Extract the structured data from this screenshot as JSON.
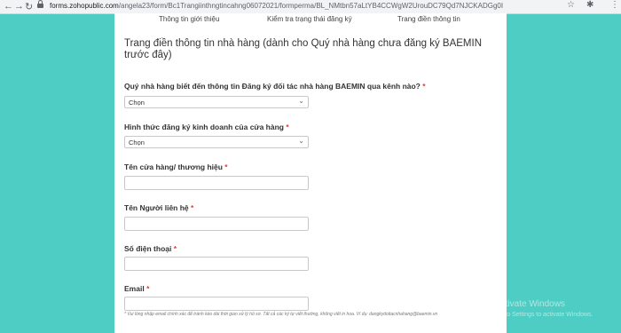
{
  "browser": {
    "back_icon": "←",
    "forward_icon": "→",
    "refresh_icon": "↻",
    "url_domain": "forms.zohopublic.com",
    "url_path": "/angela23/form/Bc1Trangiinthngtincahng06072021/formperma/BL_NMtbn57aLtYB4CCWgW2UrouDC79Qd7NJCKADGg0I",
    "star_icon": "☆",
    "extensions_icon": "✱",
    "menu_icon": "⋮"
  },
  "tabs": [
    "Thông tin giới thiệu",
    "Kiểm tra trạng thái đăng ký",
    "Trang điền thông tin"
  ],
  "form": {
    "heading": "Trang điền thông tin nhà hàng (dành cho Quý nhà hàng chưa đăng ký BAEMIN trước đây)",
    "q1_label": "Quý nhà hàng biết đến thông tin Đăng ký đối tác nhà hàng BAEMIN qua kênh nào?",
    "q1_value": "Chọn",
    "q2_label": "Hình thức đăng ký kinh doanh của cửa hàng",
    "q2_value": "Chọn",
    "store_name_label": "Tên cửa hàng/ thương hiệu",
    "contact_label": "Tên Người liên hệ",
    "phone_label": "Số điện thoại",
    "email_label": "Email",
    "required_mark": "*",
    "email_hint": "* Vui lòng nhập email chính xác để tránh kéo dài thời gian xử lý hồ sơ. Tất cả các ký tự viết thường, không viết in hoa. Ví dụ: dangkydoitacnhahang@baemin.vn",
    "chevron": "⌄"
  },
  "watermark": {
    "line1": "Activate Windows",
    "line2": "Go to Settings to activate Windows."
  }
}
